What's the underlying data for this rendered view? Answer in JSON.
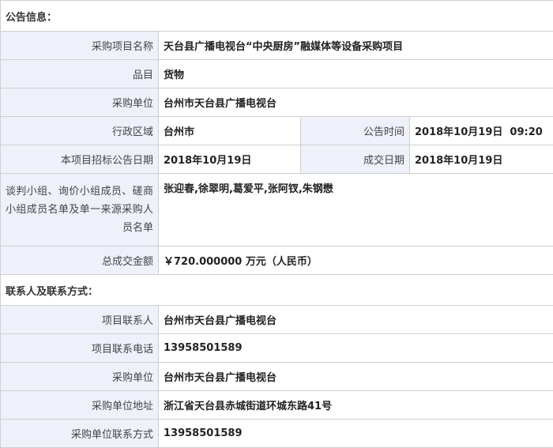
{
  "announcement": {
    "section_title": "公告信息：",
    "rows": {
      "project_name": {
        "label": "采购项目名称",
        "value": "天台县广播电视台“中央厨房”融媒体等设备采购项目"
      },
      "category": {
        "label": "品目",
        "value": "货物"
      },
      "purchaser": {
        "label": "采购单位",
        "value": "台州市天台县广播电视台"
      },
      "region": {
        "label": "行政区域",
        "value": "台州市"
      },
      "publish_time": {
        "label": "公告时间",
        "value": "2018年10月19日  09:20"
      },
      "tender_date": {
        "label": "本项目招标公告日期",
        "value": "2018年10月19日"
      },
      "deal_date": {
        "label": "成交日期",
        "value": "2018年10月19日"
      },
      "panel_members": {
        "label": "谈判小组、询价小组成员、磋商小组成员名单及单一来源采购人员名单",
        "value": "张迎春,徐翠明,葛爱平,张阿钗,朱钢懋"
      },
      "total_amount": {
        "label": "总成交金额",
        "value": "￥720.000000 万元（人民币）"
      }
    }
  },
  "contacts": {
    "section_title": "联系人及联系方式：",
    "rows": {
      "project_contact": {
        "label": "项目联系人",
        "value": "台州市天台县广播电视台"
      },
      "project_phone": {
        "label": "项目联系电话",
        "value": "13958501589"
      },
      "purchaser": {
        "label": "采购单位",
        "value": "台州市天台县广播电视台"
      },
      "purchaser_address": {
        "label": "采购单位地址",
        "value": "浙江省天台县赤城街道环城东路41号"
      },
      "purchaser_contact": {
        "label": "采购单位联系方式",
        "value": "13958501589"
      }
    }
  }
}
